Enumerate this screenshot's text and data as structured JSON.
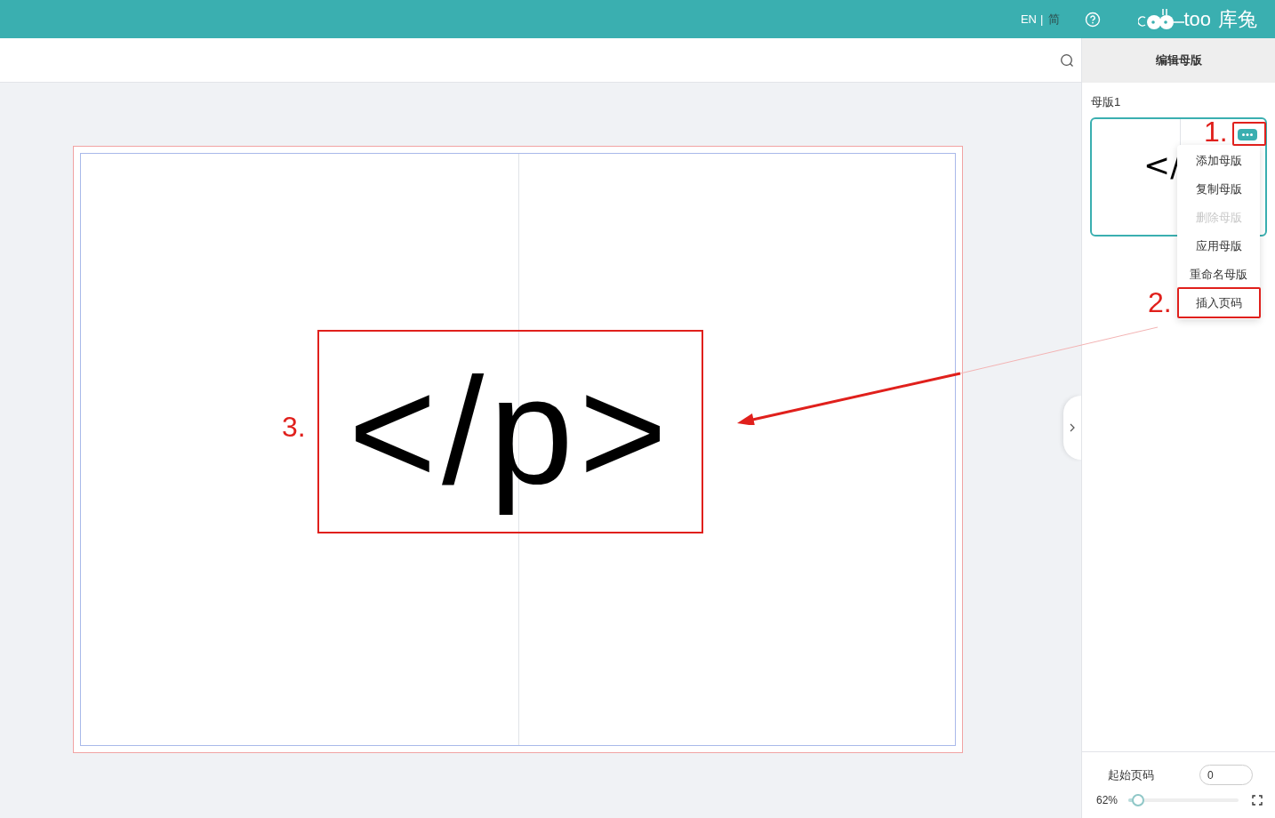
{
  "header": {
    "language": {
      "en": "EN",
      "separator": "|",
      "zh": "简"
    },
    "logo": {
      "latin": "too",
      "chinese": "库兔"
    }
  },
  "canvas": {
    "content": "</p>"
  },
  "panel": {
    "title": "编辑母版",
    "masters": [
      {
        "label": "母版1",
        "preview": "</",
        "selected": true
      }
    ],
    "menu": [
      {
        "label": "添加母版",
        "disabled": false
      },
      {
        "label": "复制母版",
        "disabled": false
      },
      {
        "label": "删除母版",
        "disabled": true
      },
      {
        "label": "应用母版",
        "disabled": false
      },
      {
        "label": "重命名母版",
        "disabled": false
      },
      {
        "label": "插入页码",
        "disabled": false
      }
    ],
    "start_page": {
      "label": "起始页码",
      "value": "0"
    },
    "zoom": {
      "reading": "62%",
      "level": 0.09
    }
  },
  "annotations": [
    {
      "label": "1."
    },
    {
      "label": "2."
    },
    {
      "label": "3."
    }
  ]
}
